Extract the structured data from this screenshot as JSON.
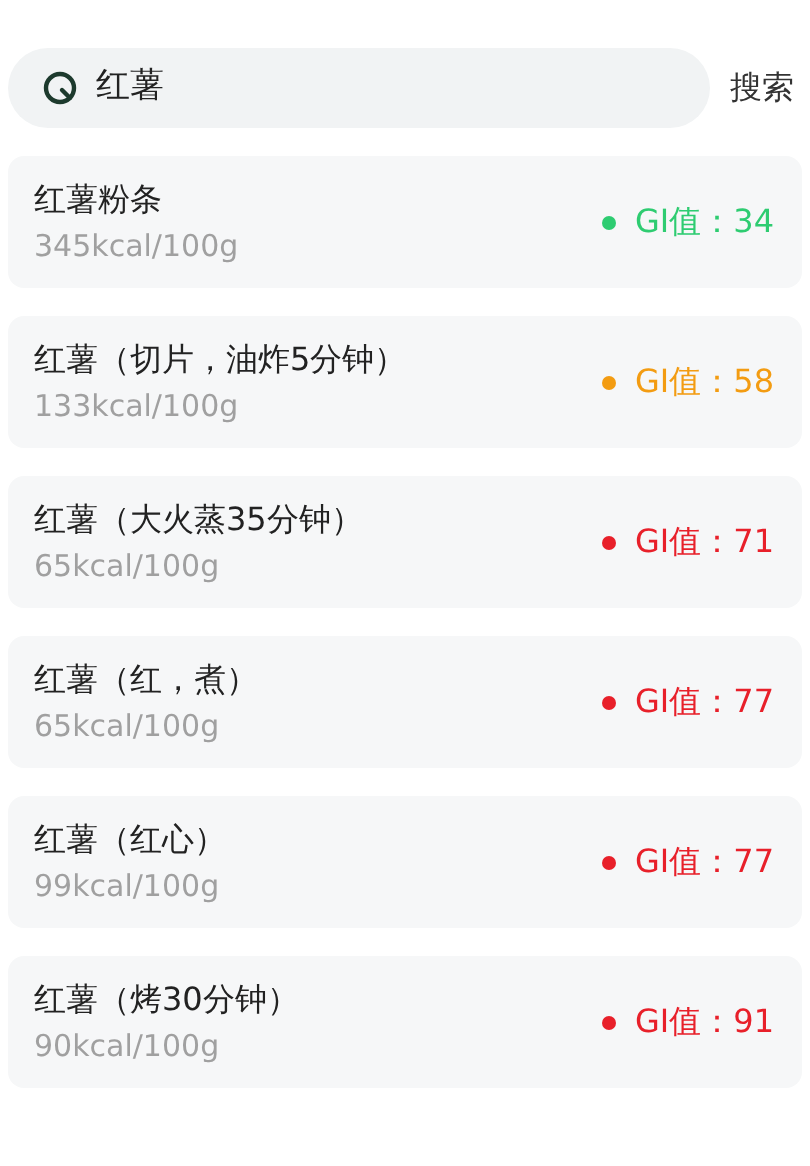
{
  "search": {
    "value": "红薯",
    "button": "搜索"
  },
  "foods": [
    {
      "name": "红薯粉条",
      "energy": "345kcal/100g",
      "gi": "GI值：34",
      "color": "#2ecc71"
    },
    {
      "name": "红薯（切片，油炸5分钟）",
      "energy": "133kcal/100g",
      "gi": "GI值：58",
      "color": "#f39c12"
    },
    {
      "name": "红薯（大火蒸35分钟）",
      "energy": "65kcal/100g",
      "gi": "GI值：71",
      "color": "#e8202a"
    },
    {
      "name": "红薯（红，煮）",
      "energy": "65kcal/100g",
      "gi": "GI值：77",
      "color": "#e8202a"
    },
    {
      "name": "红薯（红心）",
      "energy": "99kcal/100g",
      "gi": "GI值：77",
      "color": "#e8202a"
    },
    {
      "name": "红薯（烤30分钟）",
      "energy": "90kcal/100g",
      "gi": "GI值：91",
      "color": "#e8202a"
    }
  ]
}
